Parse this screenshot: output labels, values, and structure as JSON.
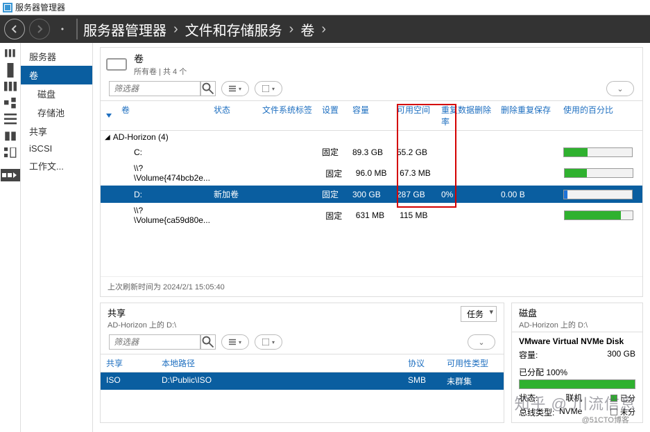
{
  "window": {
    "title": "服务器管理器"
  },
  "breadcrumb": [
    "服务器管理器",
    "文件和存储服务",
    "卷"
  ],
  "leftnav": {
    "items": [
      {
        "label": "服务器"
      },
      {
        "label": "卷",
        "active": true
      },
      {
        "label": "磁盘",
        "sub": true
      },
      {
        "label": "存储池",
        "sub": true
      },
      {
        "label": "共享"
      },
      {
        "label": "iSCSI"
      },
      {
        "label": "工作文..."
      }
    ]
  },
  "volumes_panel": {
    "title": "卷",
    "subtitle": "所有卷 | 共 4 个",
    "filter_placeholder": "筛选器",
    "columns": {
      "vol": "卷",
      "status": "状态",
      "fs": "文件系统标签",
      "prov": "设置",
      "cap": "容量",
      "free": "可用空间",
      "dedup_rate": "重复数据删除率",
      "dedup_save": "删除重复保存",
      "pct": "使用的百分比"
    },
    "group": {
      "name": "AD-Horizon (4)"
    },
    "rows": [
      {
        "vol": "C:",
        "status": "",
        "fs": "",
        "prov": "固定",
        "cap": "89.3 GB",
        "free": "55.2 GB",
        "dedup_rate": "",
        "dedup_save": "",
        "pct": 35,
        "selected": false
      },
      {
        "vol": "\\\\?\\Volume{474bcb2e...",
        "status": "",
        "fs": "",
        "prov": "固定",
        "cap": "96.0 MB",
        "free": "67.3 MB",
        "dedup_rate": "",
        "dedup_save": "",
        "pct": 32,
        "selected": false
      },
      {
        "vol": "D:",
        "status": "新加卷",
        "fs": "",
        "prov": "固定",
        "cap": "300 GB",
        "free": "287 GB",
        "dedup_rate": "0%",
        "dedup_save": "0.00 B",
        "pct": 5,
        "selected": true
      },
      {
        "vol": "\\\\?\\Volume{ca59d80e...",
        "status": "",
        "fs": "",
        "prov": "固定",
        "cap": "631 MB",
        "free": "115 MB",
        "dedup_rate": "",
        "dedup_save": "",
        "pct": 82,
        "selected": false
      }
    ],
    "refresh_text": "上次刷新时间为 2024/2/1 15:05:40"
  },
  "shares_panel": {
    "title": "共享",
    "subtitle": "AD-Horizon 上的 D:\\",
    "task_label": "任务",
    "filter_placeholder": "筛选器",
    "columns": {
      "share": "共享",
      "path": "本地路径",
      "proto": "协议",
      "avail": "可用性类型"
    },
    "rows": [
      {
        "share": "ISO",
        "path": "D:\\Public\\ISO",
        "proto": "SMB",
        "avail": "未群集",
        "selected": true
      }
    ]
  },
  "disk_panel": {
    "title": "磁盘",
    "subtitle": "AD-Horizon 上的 D:\\",
    "device": "VMware Virtual NVMe Disk",
    "cap_label": "容量:",
    "cap_value": "300 GB",
    "alloc_label": "已分配 100%",
    "state_label": "状态:",
    "state_value": "联机",
    "bus_label": "总线类型:",
    "bus_value": "NVMe",
    "legend_alloc": "已分",
    "legend_unalloc": "未分"
  },
  "watermark": "知乎 @ 川流信息",
  "subwatermark": "@51CTO博客"
}
